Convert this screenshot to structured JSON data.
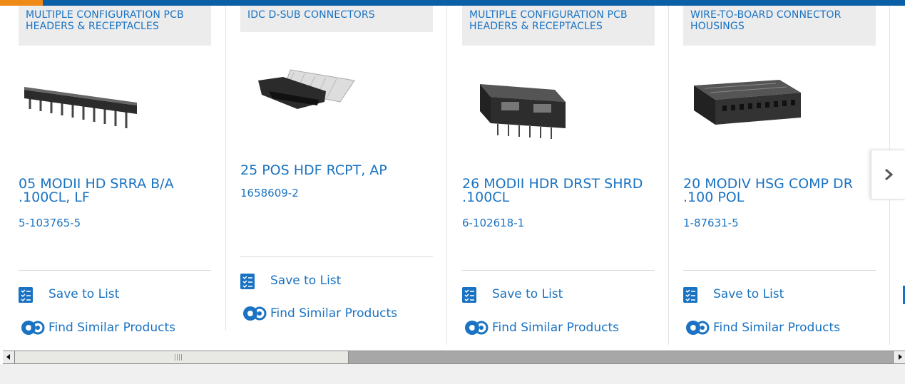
{
  "theme": {
    "accent": "#1a73c2",
    "topbar": "#0a5fa6",
    "topbar_accent": "#f08a17"
  },
  "actions": {
    "save_label": "Save to List",
    "similar_label": "Find Similar Products"
  },
  "products": [
    {
      "category": "MULTIPLE CONFIGURATION PCB HEADERS & RECEPTACLES",
      "title": "05 MODII HD SRRA B/A .100CL, LF",
      "part_number": "5-103765-5",
      "image": "right-angle-pin-header"
    },
    {
      "category": "IDC D-SUB CONNECTORS",
      "title": "25 POS HDF RCPT, AP",
      "part_number": "1658609-2",
      "image": "d-sub-ribbon-connector"
    },
    {
      "category": "MULTIPLE CONFIGURATION PCB HEADERS & RECEPTACLES",
      "title": "26 MODII HDR DRST SHRD .100CL",
      "part_number": "6-102618-1",
      "image": "shrouded-header"
    },
    {
      "category": "WIRE-TO-BOARD CONNECTOR HOUSINGS",
      "title": "20 MODIV HSG COMP DR .100 POL",
      "part_number": "1-87631-5",
      "image": "connector-housing"
    }
  ],
  "carousel": {
    "next_icon": "chevron-right-icon"
  },
  "scrollbar": {
    "left_icon": "scroll-left-icon",
    "right_icon": "scroll-right-icon"
  }
}
